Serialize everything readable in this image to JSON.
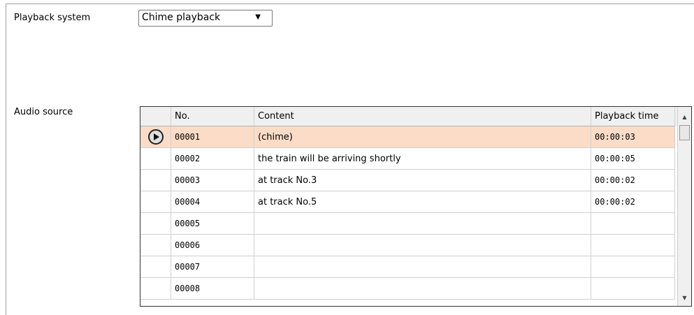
{
  "form": {
    "playback_system_label": "Playback system",
    "playback_system_value": "Chime playback",
    "audio_source_label": "Audio source"
  },
  "grid": {
    "columns": [
      "No.",
      "Content",
      "Playback time"
    ],
    "rows": [
      {
        "no": "00001",
        "content": "(chime)",
        "time": "00:00:03"
      },
      {
        "no": "00002",
        "content": "the train will be arriving shortly",
        "time": "00:00:05"
      },
      {
        "no": "00003",
        "content": "at track No.3",
        "time": "00:00:02"
      },
      {
        "no": "00004",
        "content": "at track No.5",
        "time": "00:00:02"
      },
      {
        "no": "00005",
        "content": "",
        "time": ""
      },
      {
        "no": "00006",
        "content": "",
        "time": ""
      },
      {
        "no": "00007",
        "content": "",
        "time": ""
      },
      {
        "no": "00008",
        "content": "",
        "time": ""
      }
    ],
    "selected_row": 0
  },
  "icons": {
    "play": "play-circle-icon",
    "dropdown": "chevron-down-icon",
    "scroll_up": "scroll-up-arrow-icon",
    "scroll_down": "scroll-down-arrow-icon"
  },
  "colors": {
    "selected_row": "#fbdcc6",
    "header_bg": "#f0f0f0"
  }
}
